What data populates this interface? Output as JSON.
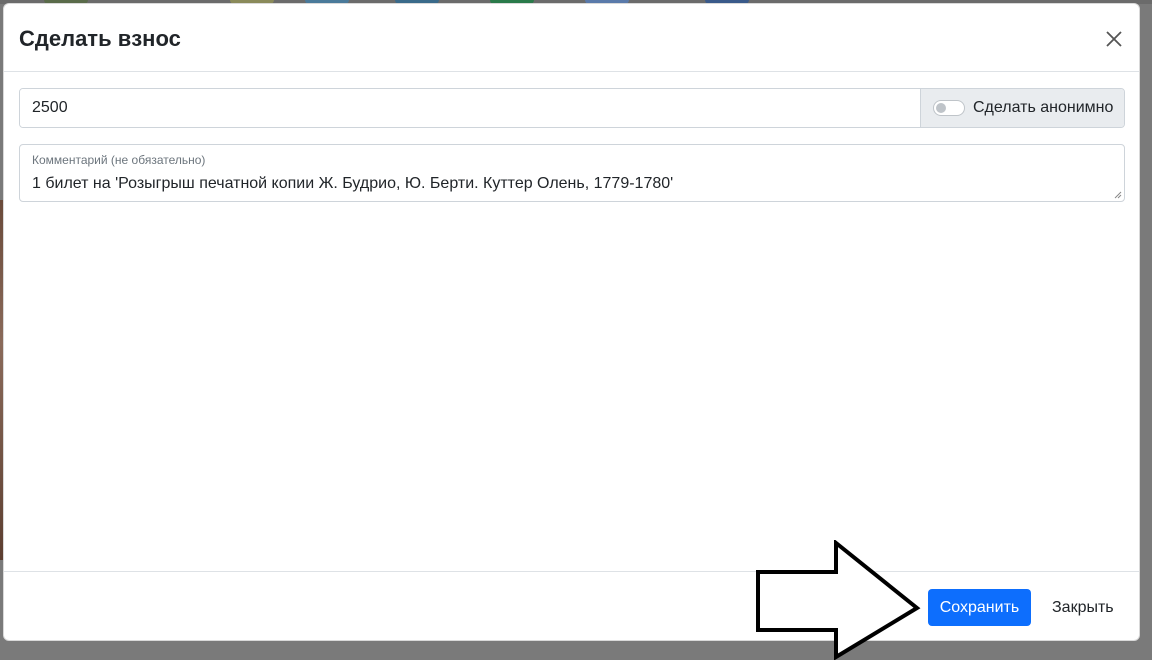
{
  "modal": {
    "title": "Сделать взнос",
    "close_icon": "close-icon"
  },
  "amount": {
    "value": "2500"
  },
  "anonymous": {
    "label": "Сделать анонимно",
    "checked": false
  },
  "comment": {
    "label": "Комментарий (не обязательно)",
    "value": "1 билет на 'Розыгрыш печатной копии Ж. Будрио, Ю. Берти. Куттер Олень, 1779-1780'"
  },
  "footer": {
    "save_label": "Сохранить",
    "close_label": "Закрыть"
  },
  "colors": {
    "primary": "#0d6efd",
    "backdrop": "#7a7a7a",
    "addon_bg": "#e9ecef"
  },
  "annotation": {
    "icon": "arrow-right-outline-icon"
  }
}
